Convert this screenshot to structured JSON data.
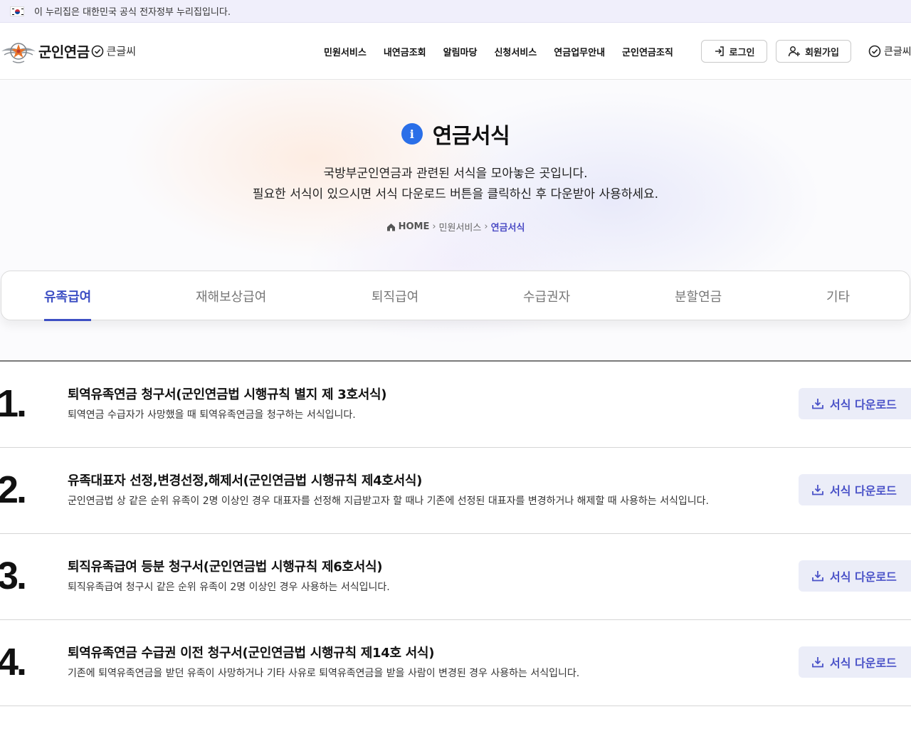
{
  "gov_banner": {
    "text": "이 누리집은 대한민국 공식 전자정부 누리집입니다."
  },
  "header": {
    "logo_text": "군인연금",
    "logo_sub": "큰글씨",
    "nav": [
      "민원서비스",
      "내연금조회",
      "알림마당",
      "신청서비스",
      "연금업무안내",
      "군인연금조직"
    ],
    "login_label": "로그인",
    "join_label": "회원가입",
    "font_label": "큰글씨"
  },
  "hero": {
    "title": "연금서식",
    "desc_line1": "국방부군인연금과 관련된 서식을 모아놓은 곳입니다.",
    "desc_line2": "필요한 서식이 있으시면 서식 다운로드 버튼을 클릭하신 후 다운받아 사용하세요.",
    "breadcrumb": {
      "home": "HOME",
      "mid": "민원서비스",
      "current": "연금서식"
    }
  },
  "tabs": [
    "유족급여",
    "재해보상급여",
    "퇴직급여",
    "수급권자",
    "분할연금",
    "기타"
  ],
  "active_tab": "유족급여",
  "forms": [
    {
      "num": "1.",
      "title": "퇴역유족연금 청구서(군인연금법 시행규칙 별지 제 3호서식)",
      "desc": "퇴역연금 수급자가 사망했을 때 퇴역유족연금을 청구하는 서식입니다."
    },
    {
      "num": "2.",
      "title": "유족대표자 선정,변경선정,해제서(군인연금법 시행규칙 제4호서식)",
      "desc": "군인연금법 상 같은 순위 유족이 2명 이상인 경우 대표자를 선정해 지급받고자 할 때나 기존에 선정된 대표자를 변경하거나 해제할 때 사용하는 서식입니다."
    },
    {
      "num": "3.",
      "title": "퇴직유족급여 등분 청구서(군인연금법 시행규칙 제6호서식)",
      "desc": "퇴직유족급여 청구시 같은 순위 유족이 2명 이상인 경우 사용하는 서식입니다."
    },
    {
      "num": "4.",
      "title": "퇴역유족연금 수급권 이전 청구서(군인연금법 시행규칙 제14호 서식)",
      "desc": "기존에 퇴역유족연금을 받던 유족이 사망하거나 기타 사유로 퇴역유족연금을 받을 사람이 변경된 경우 사용하는 서식입니다."
    }
  ],
  "download_label": "서식 다운로드",
  "colors": {
    "accent": "#3d4fc4",
    "download_bg": "#ebedf8",
    "info_icon": "#2a6fe8",
    "banner_bg": "#f0effb"
  }
}
